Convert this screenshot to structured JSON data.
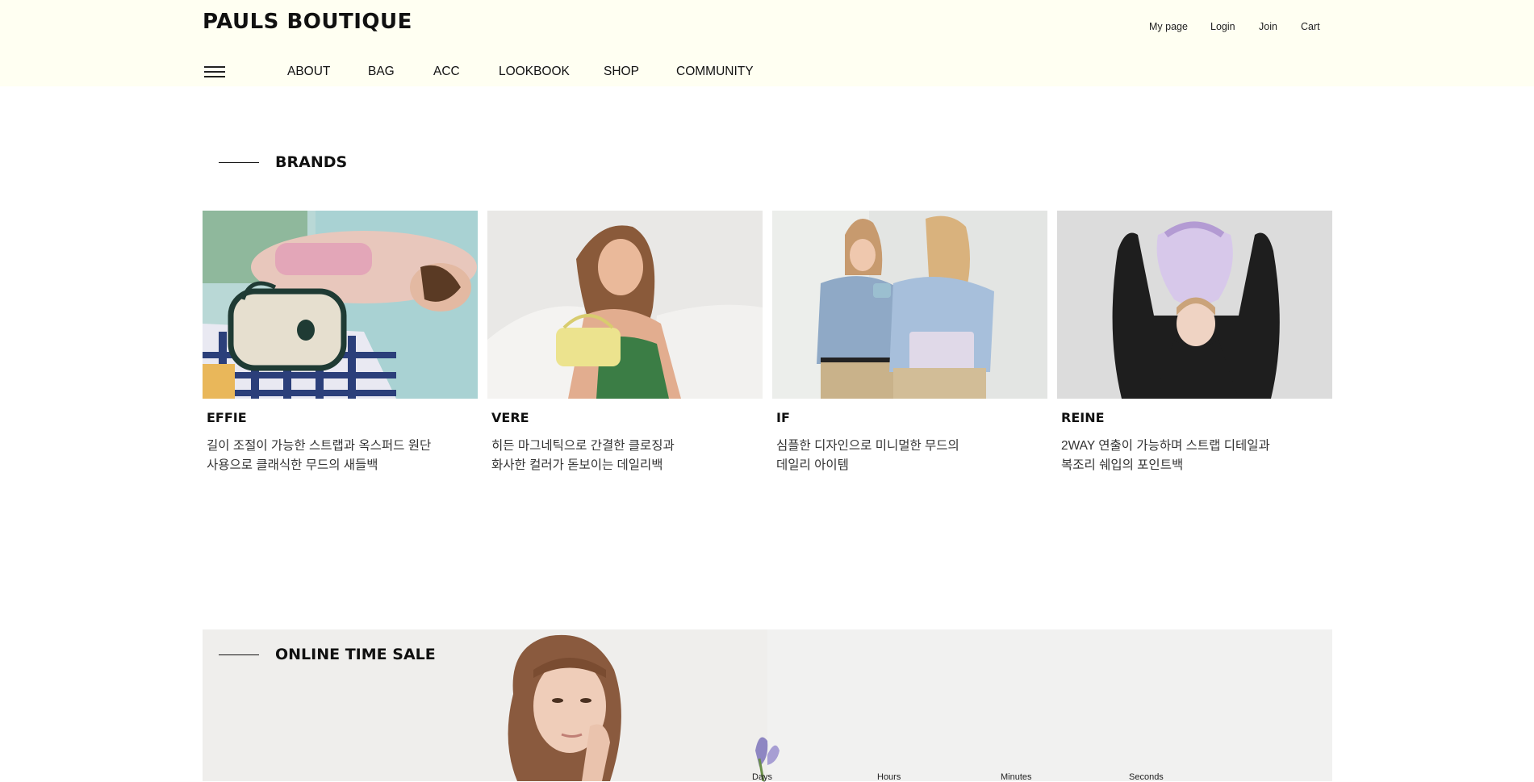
{
  "header": {
    "logo": "PAULS BOUTIQUE",
    "util_links": [
      "My page",
      "Login",
      "Join",
      "Cart"
    ],
    "nav": [
      "ABOUT",
      "BAG",
      "ACC",
      "LOOKBOOK",
      "SHOP",
      "COMMUNITY"
    ]
  },
  "brands": {
    "title": "BRANDS",
    "items": [
      {
        "name": "EFFIE",
        "desc": "길이 조절이 가능한 스트랩과 옥스퍼드 원단\n사용으로 클래식한 무드의 새들백"
      },
      {
        "name": "VERE",
        "desc": "히든 마그네틱으로 간결한 클로징과\n화사한 컬러가 돋보이는 데일리백"
      },
      {
        "name": "IF",
        "desc": "심플한 디자인으로 미니멀한 무드의\n데일리 아이템"
      },
      {
        "name": "REINE",
        "desc": "2WAY 연출이 가능하며 스트랩 디테일과\n복조리 쉐입의 포인트백"
      }
    ]
  },
  "sale": {
    "title": "ONLINE TIME SALE",
    "countdown_labels": [
      "Days",
      "Hours",
      "Minutes",
      "Seconds"
    ]
  },
  "colors": {
    "header_bg": "#fffff2",
    "sale_bg": "#efeeec"
  }
}
